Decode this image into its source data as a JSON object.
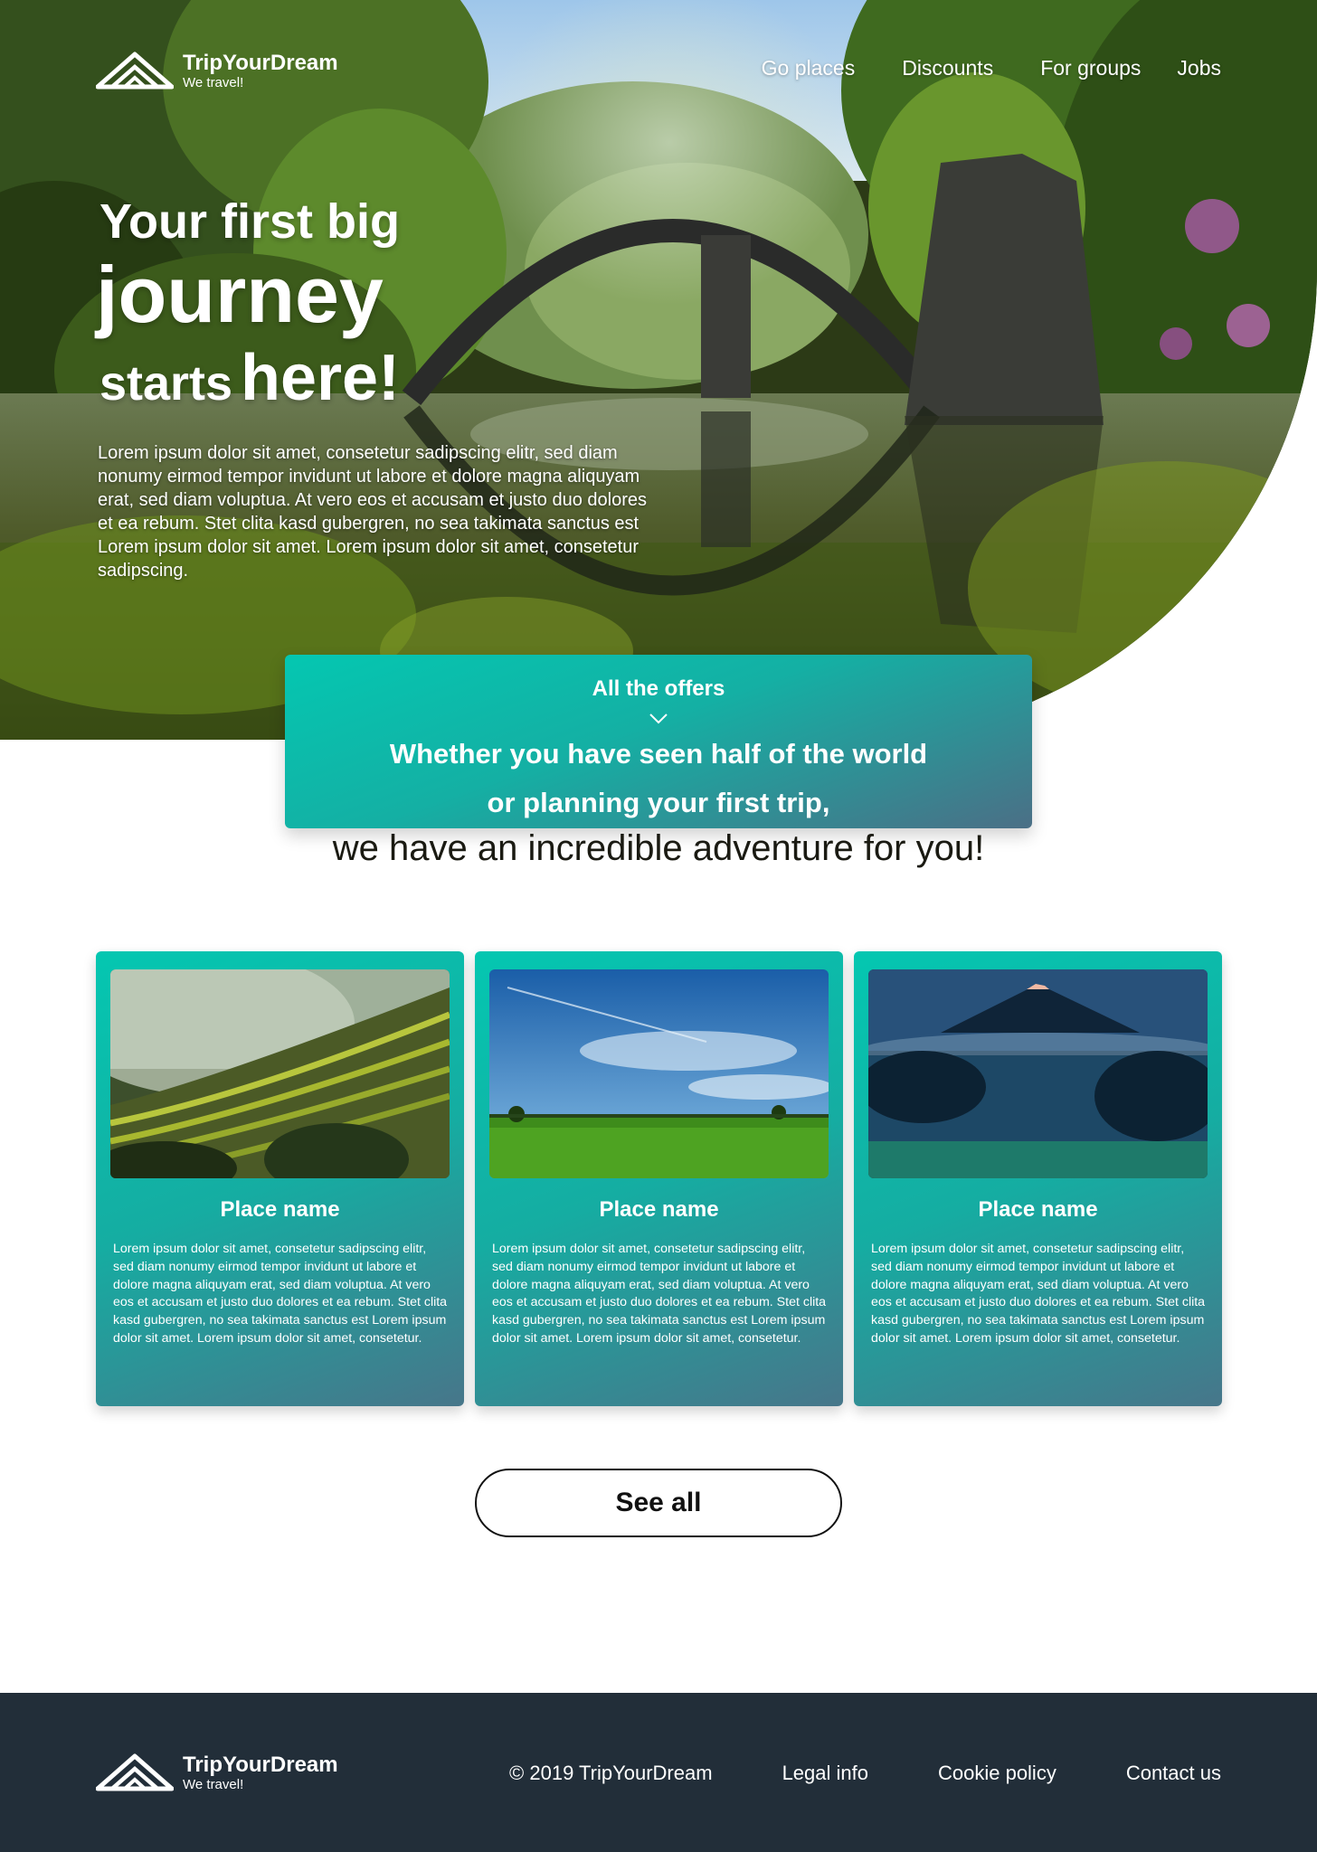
{
  "brand": {
    "name": "TripYourDream",
    "tagline": "We travel!"
  },
  "nav": {
    "items": [
      "Go places",
      "Discounts",
      "For groups",
      "Jobs"
    ]
  },
  "hero": {
    "title_line1": "Your first big",
    "title_line2": "journey",
    "title_line3a": "starts",
    "title_line3b": "here!",
    "body": "Lorem ipsum dolor sit amet, consetetur sadipscing elitr, sed diam nonumy eirmod tempor invidunt ut labore et dolore magna aliquyam erat, sed diam voluptua. At vero eos et accusam et justo duo dolores et ea rebum. Stet clita kasd gubergren, no sea takimata sanctus est Lorem ipsum dolor sit amet. Lorem ipsum dolor sit amet, consetetur sadipscing."
  },
  "offers": {
    "label": "All the offers",
    "line1": "Whether you have seen half of the world",
    "line2": "or planning your first trip,",
    "line3": "we have an incredible adventure for you!"
  },
  "cards": [
    {
      "title": "Place name",
      "image": "rice-terraces-photo",
      "description": "Lorem ipsum dolor sit amet, consetetur sadipscing elitr, sed diam nonumy eirmod tempor invidunt ut labore et dolore magna aliquyam erat, sed diam voluptua. At vero eos et accusam et justo duo dolores et ea rebum. Stet clita kasd gubergren, no sea takimata sanctus est Lorem ipsum dolor sit amet. Lorem ipsum dolor sit amet, consetetur."
    },
    {
      "title": "Place name",
      "image": "green-field-sky-photo",
      "description": "Lorem ipsum dolor sit amet, consetetur sadipscing elitr, sed diam nonumy eirmod tempor invidunt ut labore et dolore magna aliquyam erat, sed diam voluptua. At vero eos et accusam et justo duo dolores et ea rebum. Stet clita kasd gubergren, no sea takimata sanctus est Lorem ipsum dolor sit amet. Lorem ipsum dolor sit amet, consetetur."
    },
    {
      "title": "Place name",
      "image": "misty-volcano-photo",
      "description": "Lorem ipsum dolor sit amet, consetetur sadipscing elitr, sed diam nonumy eirmod tempor invidunt ut labore et dolore magna aliquyam erat, sed diam voluptua. At vero eos et accusam et justo duo dolores et ea rebum. Stet clita kasd gubergren, no sea takimata sanctus est Lorem ipsum dolor sit amet. Lorem ipsum dolor sit amet, consetetur."
    }
  ],
  "see_all": "See all",
  "footer": {
    "copyright": "© 2019 TripYourDream",
    "links": [
      "Legal info",
      "Cookie policy",
      "Contact us"
    ]
  },
  "colors": {
    "accent_teal": "#04c7b1",
    "accent_slate": "#4b6f86",
    "footer_bg": "#222e39"
  }
}
